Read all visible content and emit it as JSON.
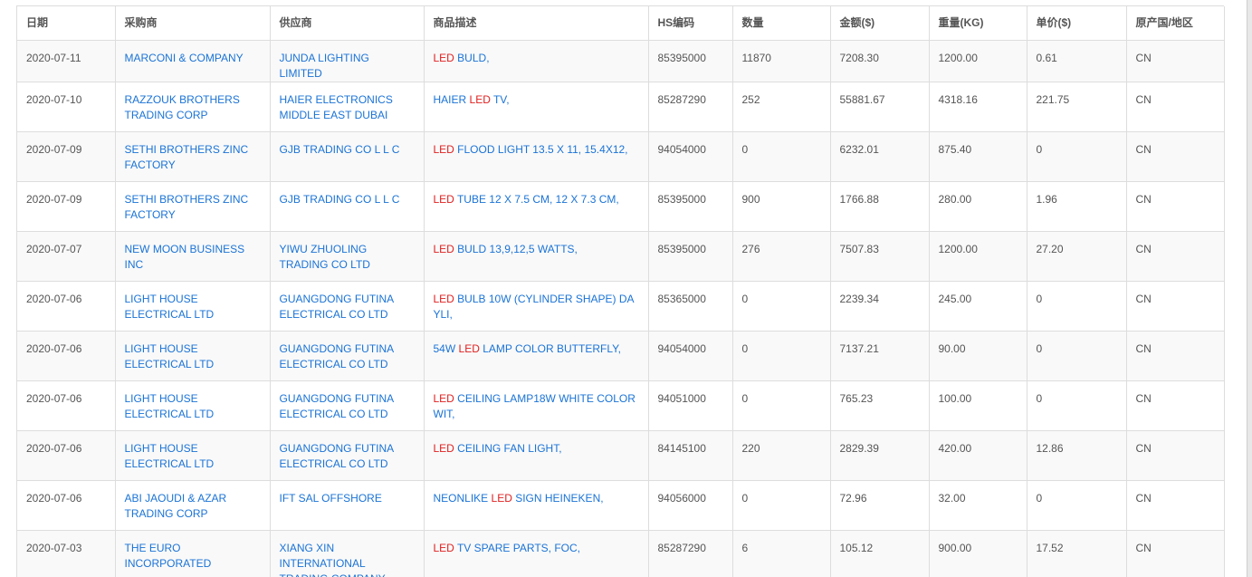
{
  "headers": [
    "日期",
    "采购商",
    "供应商",
    "商品描述",
    "HS编码",
    "数量",
    "金额($)",
    "重量(KG)",
    "单价($)",
    "原产国/地区"
  ],
  "rows": [
    {
      "date": "2020-07-11",
      "buyer": "MARCONI & COMPANY",
      "supplier": "JUNDA LIGHTING LIMITED",
      "desc_pre": "",
      "desc_hl": "LED",
      "desc_post": " BULD,",
      "hs": "85395000",
      "qty": "11870",
      "amount": "7208.30",
      "weight": "1200.00",
      "unit_price": "0.61",
      "origin": "CN"
    },
    {
      "date": "2020-07-10",
      "buyer": "RAZZOUK BROTHERS TRADING CORP",
      "supplier": "HAIER ELECTRONICS MIDDLE EAST DUBAI",
      "desc_pre": "HAIER ",
      "desc_hl": "LED",
      "desc_post": " TV,",
      "hs": "85287290",
      "qty": "252",
      "amount": "55881.67",
      "weight": "4318.16",
      "unit_price": "221.75",
      "origin": "CN"
    },
    {
      "date": "2020-07-09",
      "buyer": "SETHI BROTHERS ZINC FACTORY",
      "supplier": "GJB TRADING CO L L C",
      "desc_pre": "",
      "desc_hl": "LED",
      "desc_post": " FLOOD LIGHT 13.5 X 11, 15.4X12,",
      "hs": "94054000",
      "qty": "0",
      "amount": "6232.01",
      "weight": "875.40",
      "unit_price": "0",
      "origin": "CN"
    },
    {
      "date": "2020-07-09",
      "buyer": "SETHI BROTHERS ZINC FACTORY",
      "supplier": "GJB TRADING CO L L C",
      "desc_pre": "",
      "desc_hl": "LED",
      "desc_post": " TUBE 12 X 7.5 CM, 12 X 7.3 CM,",
      "hs": "85395000",
      "qty": "900",
      "amount": "1766.88",
      "weight": "280.00",
      "unit_price": "1.96",
      "origin": "CN"
    },
    {
      "date": "2020-07-07",
      "buyer": "NEW MOON BUSINESS INC",
      "supplier": "YIWU ZHUOLING TRADING CO LTD",
      "desc_pre": "",
      "desc_hl": "LED",
      "desc_post": " BULD 13,9,12,5 WATTS,",
      "hs": "85395000",
      "qty": "276",
      "amount": "7507.83",
      "weight": "1200.00",
      "unit_price": "27.20",
      "origin": "CN"
    },
    {
      "date": "2020-07-06",
      "buyer": "LIGHT HOUSE ELECTRICAL LTD",
      "supplier": "GUANGDONG FUTINA ELECTRICAL CO LTD",
      "desc_pre": "",
      "desc_hl": "LED",
      "desc_post": " BULB 10W (CYLINDER SHAPE) DA YLI,",
      "hs": "85365000",
      "qty": "0",
      "amount": "2239.34",
      "weight": "245.00",
      "unit_price": "0",
      "origin": "CN"
    },
    {
      "date": "2020-07-06",
      "buyer": "LIGHT HOUSE ELECTRICAL LTD",
      "supplier": "GUANGDONG FUTINA ELECTRICAL CO LTD",
      "desc_pre": "54W ",
      "desc_hl": "LED",
      "desc_post": " LAMP COLOR BUTTERFLY,",
      "hs": "94054000",
      "qty": "0",
      "amount": "7137.21",
      "weight": "90.00",
      "unit_price": "0",
      "origin": "CN"
    },
    {
      "date": "2020-07-06",
      "buyer": "LIGHT HOUSE ELECTRICAL LTD",
      "supplier": "GUANGDONG FUTINA ELECTRICAL CO LTD",
      "desc_pre": "",
      "desc_hl": "LED",
      "desc_post": " CEILING LAMP18W WHITE COLOR WIT,",
      "hs": "94051000",
      "qty": "0",
      "amount": "765.23",
      "weight": "100.00",
      "unit_price": "0",
      "origin": "CN"
    },
    {
      "date": "2020-07-06",
      "buyer": "LIGHT HOUSE ELECTRICAL LTD",
      "supplier": "GUANGDONG FUTINA ELECTRICAL CO LTD",
      "desc_pre": "",
      "desc_hl": "LED",
      "desc_post": " CEILING FAN LIGHT,",
      "hs": "84145100",
      "qty": "220",
      "amount": "2829.39",
      "weight": "420.00",
      "unit_price": "12.86",
      "origin": "CN"
    },
    {
      "date": "2020-07-06",
      "buyer": "ABI JAOUDI & AZAR TRADING CORP",
      "supplier": "IFT SAL OFFSHORE",
      "desc_pre": "NEONLIKE ",
      "desc_hl": "LED",
      "desc_post": " SIGN HEINEKEN,",
      "hs": "94056000",
      "qty": "0",
      "amount": "72.96",
      "weight": "32.00",
      "unit_price": "0",
      "origin": "CN"
    },
    {
      "date": "2020-07-03",
      "buyer": "THE EURO INCORPORATED",
      "supplier": "XIANG XIN INTERNATIONAL TRADING COMPANY LIMITED",
      "desc_pre": "",
      "desc_hl": "LED",
      "desc_post": " TV SPARE PARTS, FOC,",
      "hs": "85287290",
      "qty": "6",
      "amount": "105.12",
      "weight": "900.00",
      "unit_price": "17.52",
      "origin": "CN"
    }
  ],
  "colors": {
    "link": "#1a73d6",
    "highlight": "#e02020",
    "text": "#555555",
    "border": "#dddddd",
    "stripe": "#f9f9f9"
  }
}
